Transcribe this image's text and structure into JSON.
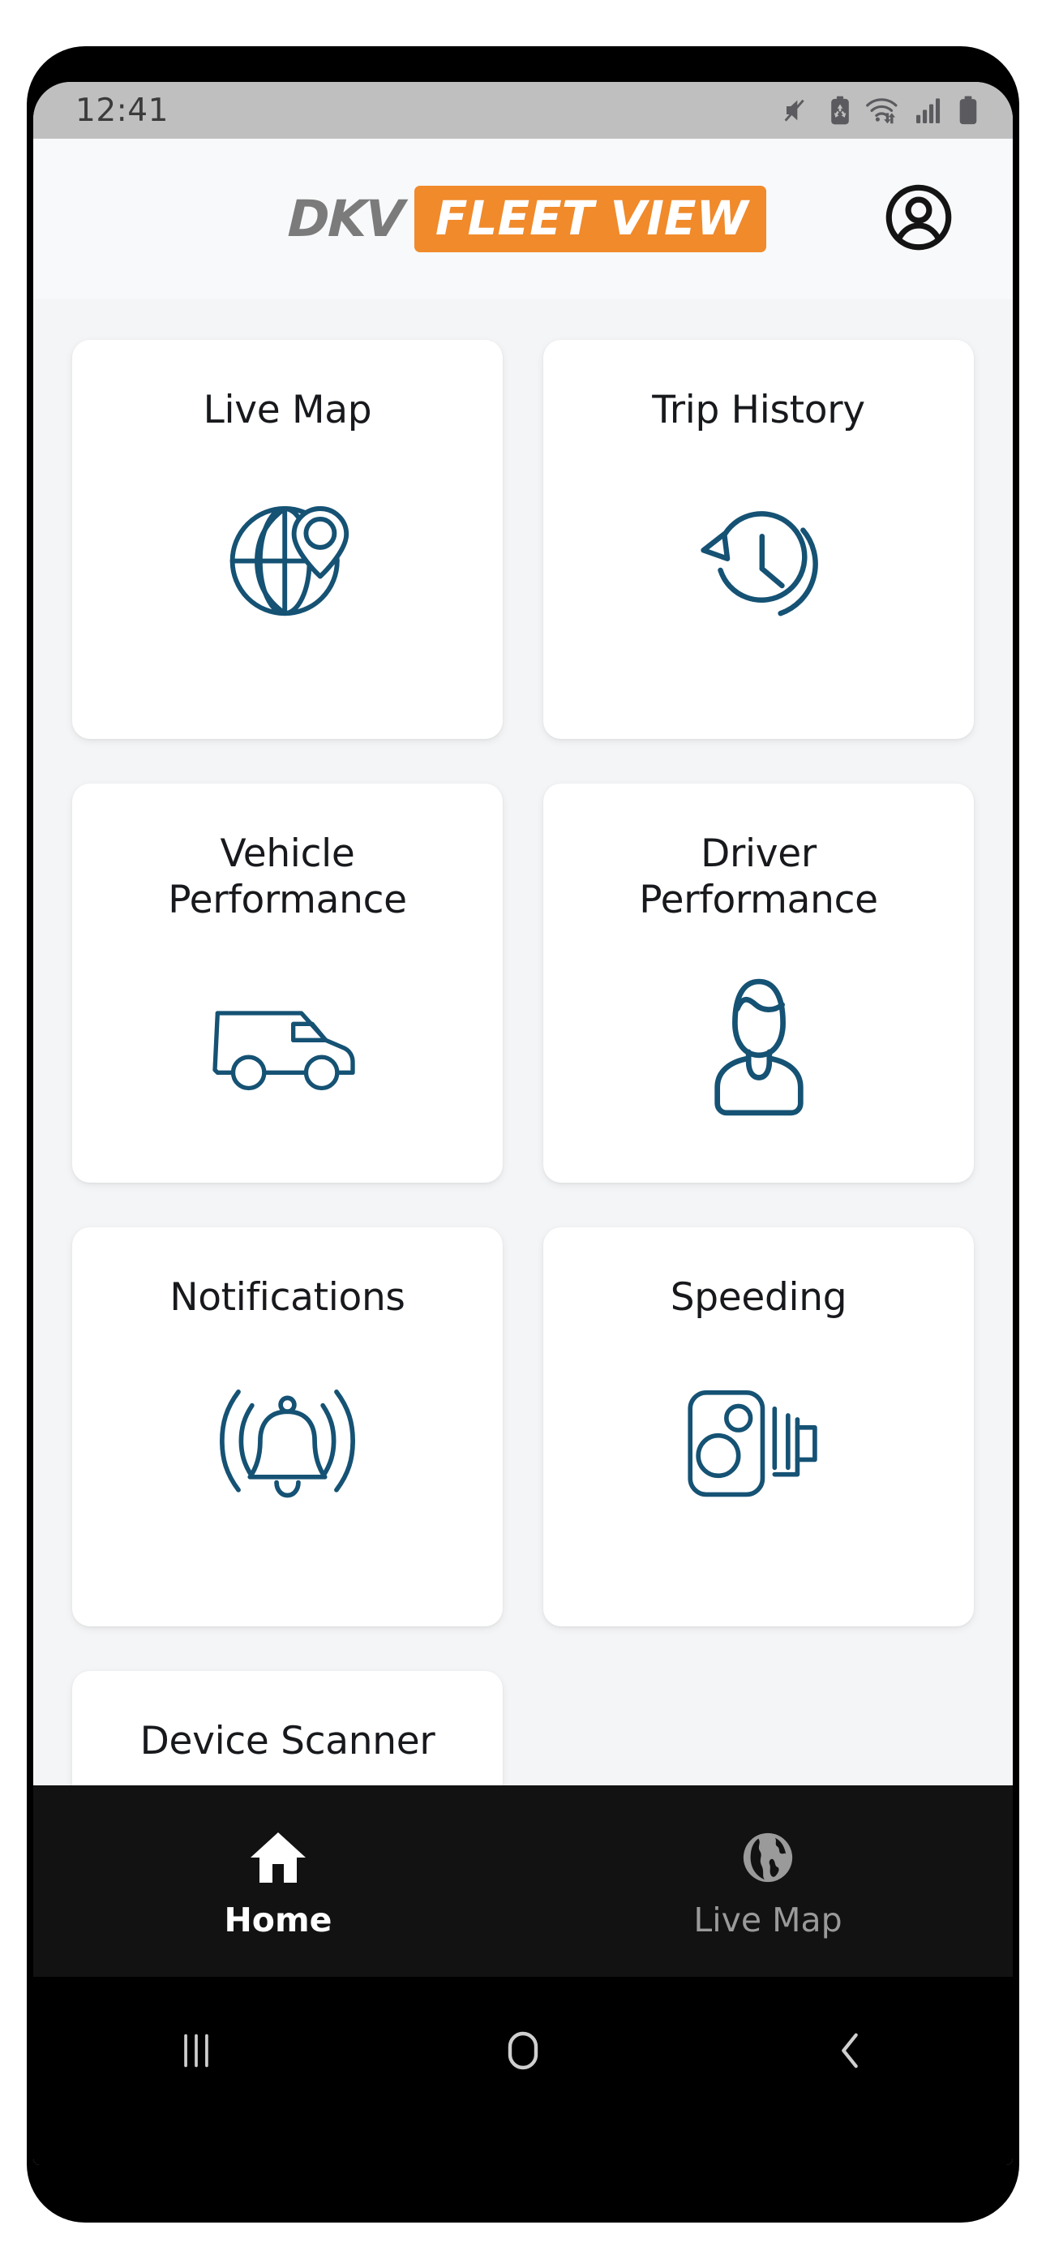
{
  "status_bar": {
    "time": "12:41",
    "icons": [
      "volume-mute-icon",
      "battery-saver-icon",
      "wifi-transfer-icon",
      "cellular-signal-icon",
      "battery-icon"
    ]
  },
  "header": {
    "brand_primary": "DKV",
    "brand_secondary": "FLEET VIEW",
    "brand_primary_color": "#7b7b7b",
    "brand_secondary_bg": "#f08a2b",
    "brand_secondary_color": "#ffffff",
    "account_icon": "account-circle-icon"
  },
  "theme": {
    "page_bg": "#f4f5f7",
    "card_bg": "#ffffff",
    "icon_accent": "#155274",
    "nav_bg": "#121212",
    "nav_active_color": "#ffffff",
    "nav_inactive_color": "#9a9a9a"
  },
  "tiles": [
    {
      "label": "Live Map",
      "icon": "globe-pin-icon"
    },
    {
      "label": "Trip History",
      "icon": "clock-history-icon"
    },
    {
      "label": "Vehicle\nPerformance",
      "label_line1": "Vehicle",
      "label_line2": "Performance",
      "icon": "van-icon"
    },
    {
      "label": "Driver\nPerformance",
      "label_line1": "Driver",
      "label_line2": "Performance",
      "icon": "driver-person-icon"
    },
    {
      "label": "Notifications",
      "icon": "ringing-bell-icon"
    },
    {
      "label": "Speeding",
      "icon": "speed-camera-icon"
    },
    {
      "label": "Device Scanner",
      "icon": "scanner-icon"
    }
  ],
  "bottom_nav": {
    "items": [
      {
        "label": "Home",
        "icon": "home-icon",
        "active": true
      },
      {
        "label": "Live Map",
        "icon": "earth-globe-icon",
        "active": false
      }
    ]
  },
  "system_nav": {
    "buttons": [
      "recents-icon",
      "home-square-icon",
      "back-chevron-icon"
    ]
  }
}
